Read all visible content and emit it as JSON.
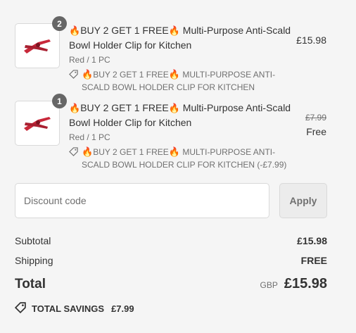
{
  "items": [
    {
      "quantity": "2",
      "title": "BUY 2 GET 1 FREE",
      "title_rest": "Multi-Purpose Anti-Scald Bowl Holder Clip for Kitchen",
      "variant": "Red / 1 PC",
      "discount_a": "BUY 2 GET 1 FREE",
      "discount_b": "MULTI-PURPOSE ANTI-SCALD BOWL HOLDER CLIP FOR KITCHEN",
      "price": "£15.98",
      "original_price": "",
      "thumbnail_icon": "bowl-clip-product-image"
    },
    {
      "quantity": "1",
      "title": "BUY 2 GET 1 FREE",
      "title_rest": "Multi-Purpose Anti-Scald Bowl Holder Clip for Kitchen",
      "variant": "Red / 1 PC",
      "discount_a": "BUY 2 GET 1 FREE",
      "discount_b": "MULTI-PURPOSE ANTI-SCALD BOWL HOLDER CLIP FOR KITCHEN (-£7.99)",
      "price": "Free",
      "original_price": "£7.99",
      "thumbnail_icon": "bowl-clip-product-image"
    }
  ],
  "discount": {
    "placeholder": "Discount code",
    "apply_label": "Apply"
  },
  "summary": {
    "subtotal_label": "Subtotal",
    "subtotal_value": "£15.98",
    "shipping_label": "Shipping",
    "shipping_value": "FREE",
    "total_label": "Total",
    "currency": "GBP",
    "total_value": "£15.98",
    "savings_label": "TOTAL SAVINGS",
    "savings_value": "£7.99"
  },
  "colors": {
    "background": "#f5f5f5",
    "product_red": "#c8283a",
    "flame": "#e8771b",
    "badge": "#666666"
  }
}
